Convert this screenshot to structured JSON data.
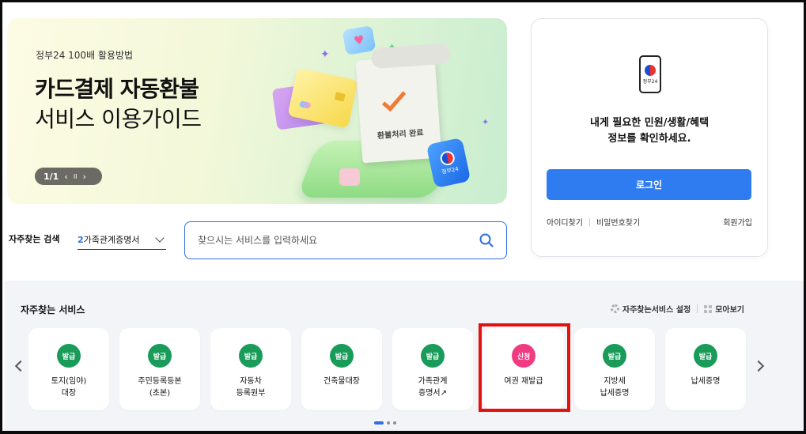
{
  "banner": {
    "subtitle": "정부24 100배 활용방법",
    "title_line1": "카드결제 자동환불",
    "title_line2": "서비스 이용가이드",
    "pager_current": "1/1",
    "pager_prev": "‹",
    "pager_pause": "II",
    "pager_next": "›",
    "receipt_text": "환불처리 완료",
    "badge_text": "정부24"
  },
  "login_panel": {
    "app_label": "정부24",
    "message_line1": "내게 필요한 민원/생활/혜택",
    "message_line2": "정보를 확인하세요.",
    "login_button": "로그인",
    "find_id": "아이디찾기",
    "find_password": "비밀번호찾기",
    "join": "회원가입"
  },
  "quick_search": {
    "label": "자주찾는 검색",
    "selected_num": "2",
    "selected_text": "가족관계증명서",
    "search_placeholder": "찾으시는 서비스를 입력하세요"
  },
  "services": {
    "title": "자주찾는 서비스",
    "settings_label": "자주찾는서비스 설정",
    "collect_label": "모아보기",
    "tiles": [
      {
        "badge": "발급",
        "label": "토지(임야)\n대장"
      },
      {
        "badge": "발급",
        "label": "주민등록등본\n(초본)"
      },
      {
        "badge": "발급",
        "label": "자동차\n등록원부"
      },
      {
        "badge": "발급",
        "label": "건축물대장"
      },
      {
        "badge": "발급",
        "label": "가족관계\n증명서↗"
      },
      {
        "badge": "신청",
        "label": "여권 재발급"
      },
      {
        "badge": "발급",
        "label": "지방세\n납세증명"
      },
      {
        "badge": "발급",
        "label": "납세증명"
      }
    ]
  },
  "colors": {
    "primary": "#2f7cf0",
    "issue_badge": "#199b5a",
    "apply_badge": "#f03a82",
    "highlight_box": "#e4120f"
  }
}
